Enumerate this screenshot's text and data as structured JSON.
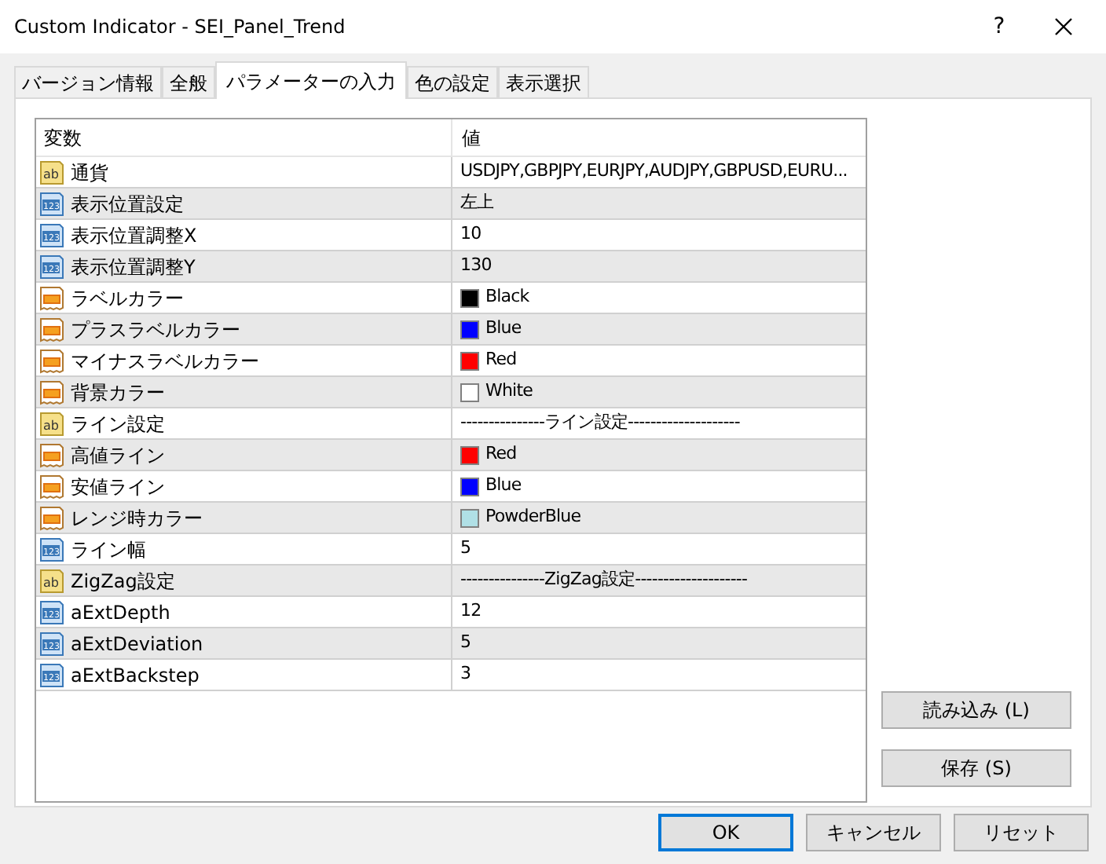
{
  "window": {
    "title": "Custom Indicator - SEI_Panel_Trend",
    "help": "?"
  },
  "tabs": [
    {
      "label": "バージョン情報",
      "selected": false
    },
    {
      "label": "全般",
      "selected": false
    },
    {
      "label": "パラメーターの入力",
      "selected": true
    },
    {
      "label": "色の設定",
      "selected": false
    },
    {
      "label": "表示選択",
      "selected": false
    }
  ],
  "table": {
    "columns": [
      "変数",
      "値"
    ],
    "rows": [
      {
        "kind": "string",
        "icon": "ab",
        "name": "通貨",
        "value": "USDJPY,GBPJPY,EURJPY,AUDJPY,GBPUSD,EURU..."
      },
      {
        "kind": "int",
        "icon": "123",
        "name": "表示位置設定",
        "value": "左上"
      },
      {
        "kind": "int",
        "icon": "123",
        "name": "表示位置調整X",
        "value": "10"
      },
      {
        "kind": "int",
        "icon": "123",
        "name": "表示位置調整Y",
        "value": "130"
      },
      {
        "kind": "color",
        "name": "ラベルカラー",
        "value": "Black",
        "color": "#000000"
      },
      {
        "kind": "color",
        "name": "プラスラベルカラー",
        "value": "Blue",
        "color": "#0000ff"
      },
      {
        "kind": "color",
        "name": "マイナスラベルカラー",
        "value": "Red",
        "color": "#ff0000"
      },
      {
        "kind": "color",
        "name": "背景カラー",
        "value": "White",
        "color": "#ffffff"
      },
      {
        "kind": "string",
        "icon": "ab",
        "name": "ライン設定",
        "value": "---------------ライン設定--------------------"
      },
      {
        "kind": "color",
        "name": "高値ライン",
        "value": "Red",
        "color": "#ff0000"
      },
      {
        "kind": "color",
        "name": "安値ライン",
        "value": "Blue",
        "color": "#0000ff"
      },
      {
        "kind": "color",
        "name": "レンジ時カラー",
        "value": "PowderBlue",
        "color": "#b0e0e6"
      },
      {
        "kind": "int",
        "icon": "123",
        "name": "ライン幅",
        "value": "5"
      },
      {
        "kind": "string",
        "icon": "ab",
        "name": "ZigZag設定",
        "value": "---------------ZigZag設定--------------------"
      },
      {
        "kind": "int",
        "icon": "123",
        "name": "aExtDepth",
        "value": "12"
      },
      {
        "kind": "int",
        "icon": "123",
        "name": "aExtDeviation",
        "value": "5"
      },
      {
        "kind": "int",
        "icon": "123",
        "name": "aExtBackstep",
        "value": "3"
      }
    ]
  },
  "side_buttons": [
    "読み込み (L)",
    "保存 (S)"
  ],
  "buttons": [
    {
      "label": "OK",
      "default": true
    },
    {
      "label": "キャンセル",
      "default": false
    },
    {
      "label": "リセット",
      "default": false
    }
  ]
}
